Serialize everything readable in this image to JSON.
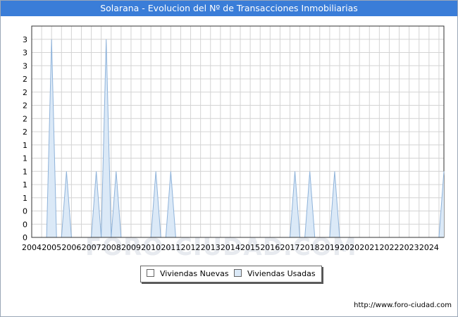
{
  "title": "Solarana - Evolucion del Nº de Transacciones Inmobiliarias",
  "source": "http://www.foro-ciudad.com",
  "watermark": "FORO-CIUDAD.COM",
  "colors": {
    "title_bg": "#3a7dd8",
    "usadas_fill": "#dbe9f7",
    "usadas_stroke": "#8fb3da",
    "nuevas_fill": "#ffffff",
    "grid": "#d4d4d4"
  },
  "chart_data": {
    "type": "area",
    "title": "Solarana - Evolucion del Nº de Transacciones Inmobiliarias",
    "xlabel": "",
    "ylabel": "",
    "xlim": [
      2004,
      2024.75
    ],
    "ylim": [
      0,
      3.2
    ],
    "grid": true,
    "legend_position": "bottom-center",
    "x_tick_labels": [
      "2004",
      "2005",
      "2006",
      "2007",
      "2008",
      "2009",
      "2010",
      "2011",
      "2012",
      "2013",
      "2014",
      "2015",
      "2016",
      "2017",
      "2018",
      "2019",
      "2020",
      "2021",
      "2022",
      "2023",
      "2024"
    ],
    "y_tick_values": [
      0,
      0.2,
      0.4,
      0.6,
      0.8,
      1.0,
      1.2,
      1.4,
      1.6,
      1.8,
      2.0,
      2.2,
      2.4,
      2.6,
      2.8,
      3.0,
      3.2
    ],
    "y_tick_labels": [
      "0",
      "0",
      "0",
      "1",
      "1",
      "1",
      "1",
      "1",
      "2",
      "2",
      "2",
      "2",
      "2",
      "3",
      "3",
      "3",
      "3"
    ],
    "series": [
      {
        "name": "Viviendas Nuevas",
        "values": []
      },
      {
        "name": "Viviendas Usadas",
        "points": [
          {
            "x": 2004.75,
            "y": 0
          },
          {
            "x": 2005.0,
            "y": 3
          },
          {
            "x": 2005.25,
            "y": 0
          },
          {
            "x": 2005.5,
            "y": 0
          },
          {
            "x": 2005.75,
            "y": 1
          },
          {
            "x": 2006.0,
            "y": 0
          },
          {
            "x": 2007.0,
            "y": 0
          },
          {
            "x": 2007.25,
            "y": 1
          },
          {
            "x": 2007.5,
            "y": 0
          },
          {
            "x": 2007.75,
            "y": 3
          },
          {
            "x": 2008.0,
            "y": 0
          },
          {
            "x": 2008.25,
            "y": 1
          },
          {
            "x": 2008.5,
            "y": 0
          },
          {
            "x": 2010.0,
            "y": 0
          },
          {
            "x": 2010.25,
            "y": 1
          },
          {
            "x": 2010.5,
            "y": 0
          },
          {
            "x": 2010.75,
            "y": 0
          },
          {
            "x": 2011.0,
            "y": 1
          },
          {
            "x": 2011.25,
            "y": 0
          },
          {
            "x": 2017.0,
            "y": 0
          },
          {
            "x": 2017.25,
            "y": 1
          },
          {
            "x": 2017.5,
            "y": 0
          },
          {
            "x": 2017.75,
            "y": 0
          },
          {
            "x": 2018.0,
            "y": 1
          },
          {
            "x": 2018.25,
            "y": 0
          },
          {
            "x": 2019.0,
            "y": 0
          },
          {
            "x": 2019.25,
            "y": 1
          },
          {
            "x": 2019.5,
            "y": 0
          },
          {
            "x": 2024.5,
            "y": 0
          },
          {
            "x": 2024.75,
            "y": 1
          }
        ]
      }
    ]
  }
}
